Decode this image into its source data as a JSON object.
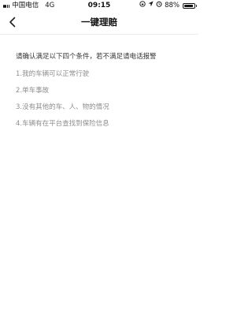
{
  "status_bar": {
    "carrier": "中国电信",
    "network": "4G",
    "time": "09:15",
    "battery_percent": "88%",
    "battery_level": 0.88,
    "icons": [
      "signal-icon",
      "lock-rotation-icon",
      "location-icon",
      "alarm-icon",
      "battery-icon"
    ]
  },
  "nav": {
    "title": "一键理赔",
    "back_icon": "chevron-left-icon"
  },
  "content": {
    "intro": "请确认满足以下四个条件，若不满足请电话报警",
    "conditions": [
      "1.我的车辆可以正常行驶",
      "2.单车事故",
      "3.没有其他的车、人、物的情况",
      "4.车辆有在平台查找到保险信息"
    ]
  }
}
